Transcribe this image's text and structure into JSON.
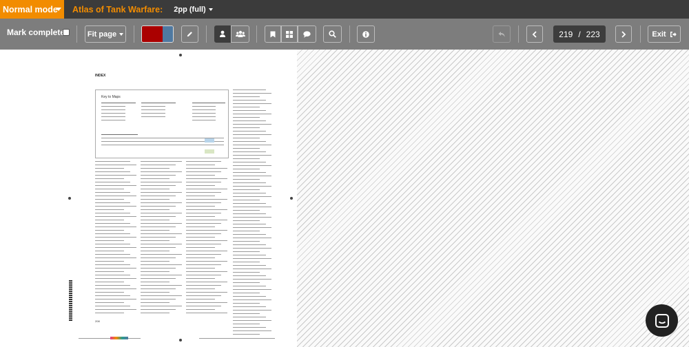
{
  "topbar": {
    "mode_label": "Normal mode",
    "book_title": "Atlas of Tank Warfare:",
    "layout_label": "2pp (full)"
  },
  "toolbar": {
    "mark_complete_label": "Mark complete",
    "mark_complete_checked": false,
    "fit_label": "Fit page",
    "highlight_colors": [
      "#aa0000",
      "#4f79a1"
    ],
    "icons": [
      "pencil-icon",
      "user-icon",
      "group-icon",
      "bookmark-icon",
      "grid-icon",
      "comment-icon",
      "search-icon",
      "info-icon",
      "undo-icon",
      "chevron-left-icon",
      "chevron-right-icon",
      "exit-icon"
    ],
    "current_page": "219",
    "page_separator": "/",
    "total_pages": "223",
    "exit_label": "Exit"
  },
  "document": {
    "page_heading": "INDEX",
    "key_title": "Key to Maps",
    "page_number": "208"
  },
  "colors": {
    "accent": "#f28c00",
    "topbar": "#3b3b3b",
    "toolbar": "#7d7d7d",
    "dark_button": "#3d3d3d"
  }
}
